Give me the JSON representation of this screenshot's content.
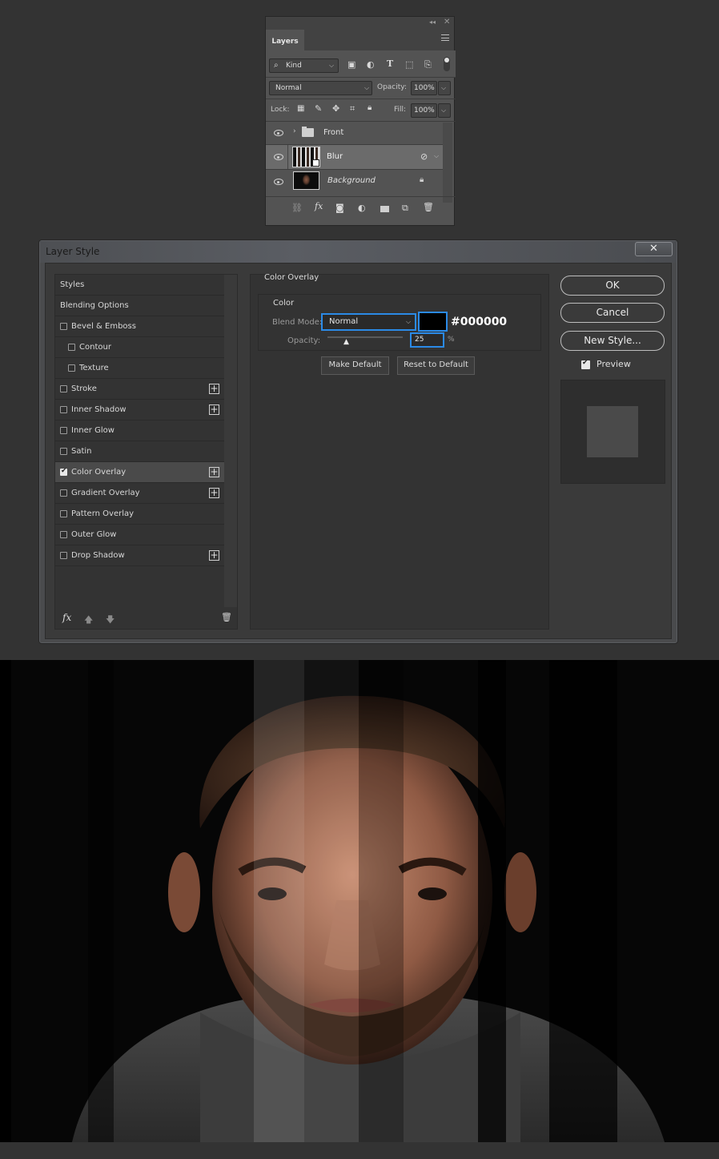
{
  "layers_panel": {
    "tab_label": "Layers",
    "filter_kind": "Kind",
    "blend_mode": "Normal",
    "opacity_label": "Opacity:",
    "opacity_value": "100%",
    "lock_label": "Lock:",
    "fill_label": "Fill:",
    "fill_value": "100%",
    "layers": [
      {
        "name": "Front",
        "type": "group",
        "visible": true
      },
      {
        "name": "Blur",
        "type": "smart-object",
        "visible": true,
        "selected": true
      },
      {
        "name": "Background",
        "type": "image",
        "visible": true,
        "locked": true
      }
    ]
  },
  "dialog": {
    "title": "Layer Style",
    "close_glyph": "✕",
    "styles": [
      {
        "label": "Styles",
        "checkbox": false,
        "checked": false,
        "plus": false,
        "indent": false
      },
      {
        "label": "Blending Options",
        "checkbox": false,
        "checked": false,
        "plus": false,
        "indent": false
      },
      {
        "label": "Bevel & Emboss",
        "checkbox": true,
        "checked": false,
        "plus": false,
        "indent": false
      },
      {
        "label": "Contour",
        "checkbox": true,
        "checked": false,
        "plus": false,
        "indent": true
      },
      {
        "label": "Texture",
        "checkbox": true,
        "checked": false,
        "plus": false,
        "indent": true
      },
      {
        "label": "Stroke",
        "checkbox": true,
        "checked": false,
        "plus": true,
        "indent": false
      },
      {
        "label": "Inner Shadow",
        "checkbox": true,
        "checked": false,
        "plus": true,
        "indent": false
      },
      {
        "label": "Inner Glow",
        "checkbox": true,
        "checked": false,
        "plus": false,
        "indent": false
      },
      {
        "label": "Satin",
        "checkbox": true,
        "checked": false,
        "plus": false,
        "indent": false
      },
      {
        "label": "Color Overlay",
        "checkbox": true,
        "checked": true,
        "plus": true,
        "indent": false,
        "selected": true
      },
      {
        "label": "Gradient Overlay",
        "checkbox": true,
        "checked": false,
        "plus": true,
        "indent": false
      },
      {
        "label": "Pattern Overlay",
        "checkbox": true,
        "checked": false,
        "plus": false,
        "indent": false
      },
      {
        "label": "Outer Glow",
        "checkbox": true,
        "checked": false,
        "plus": false,
        "indent": false
      },
      {
        "label": "Drop Shadow",
        "checkbox": true,
        "checked": false,
        "plus": true,
        "indent": false
      }
    ],
    "section_title": "Color Overlay",
    "group_title": "Color",
    "blend_mode_label": "Blend Mode:",
    "blend_mode_value": "Normal",
    "color_hex": "#000000",
    "opacity_label": "Opacity:",
    "opacity_value": "25",
    "opacity_unit": "%",
    "opacity_fraction": 0.25,
    "make_default": "Make Default",
    "reset_default": "Reset to Default",
    "ok": "OK",
    "cancel": "Cancel",
    "new_style": "New Style...",
    "preview_label": "Preview",
    "preview_checked": true,
    "fx_glyph": "fx"
  }
}
